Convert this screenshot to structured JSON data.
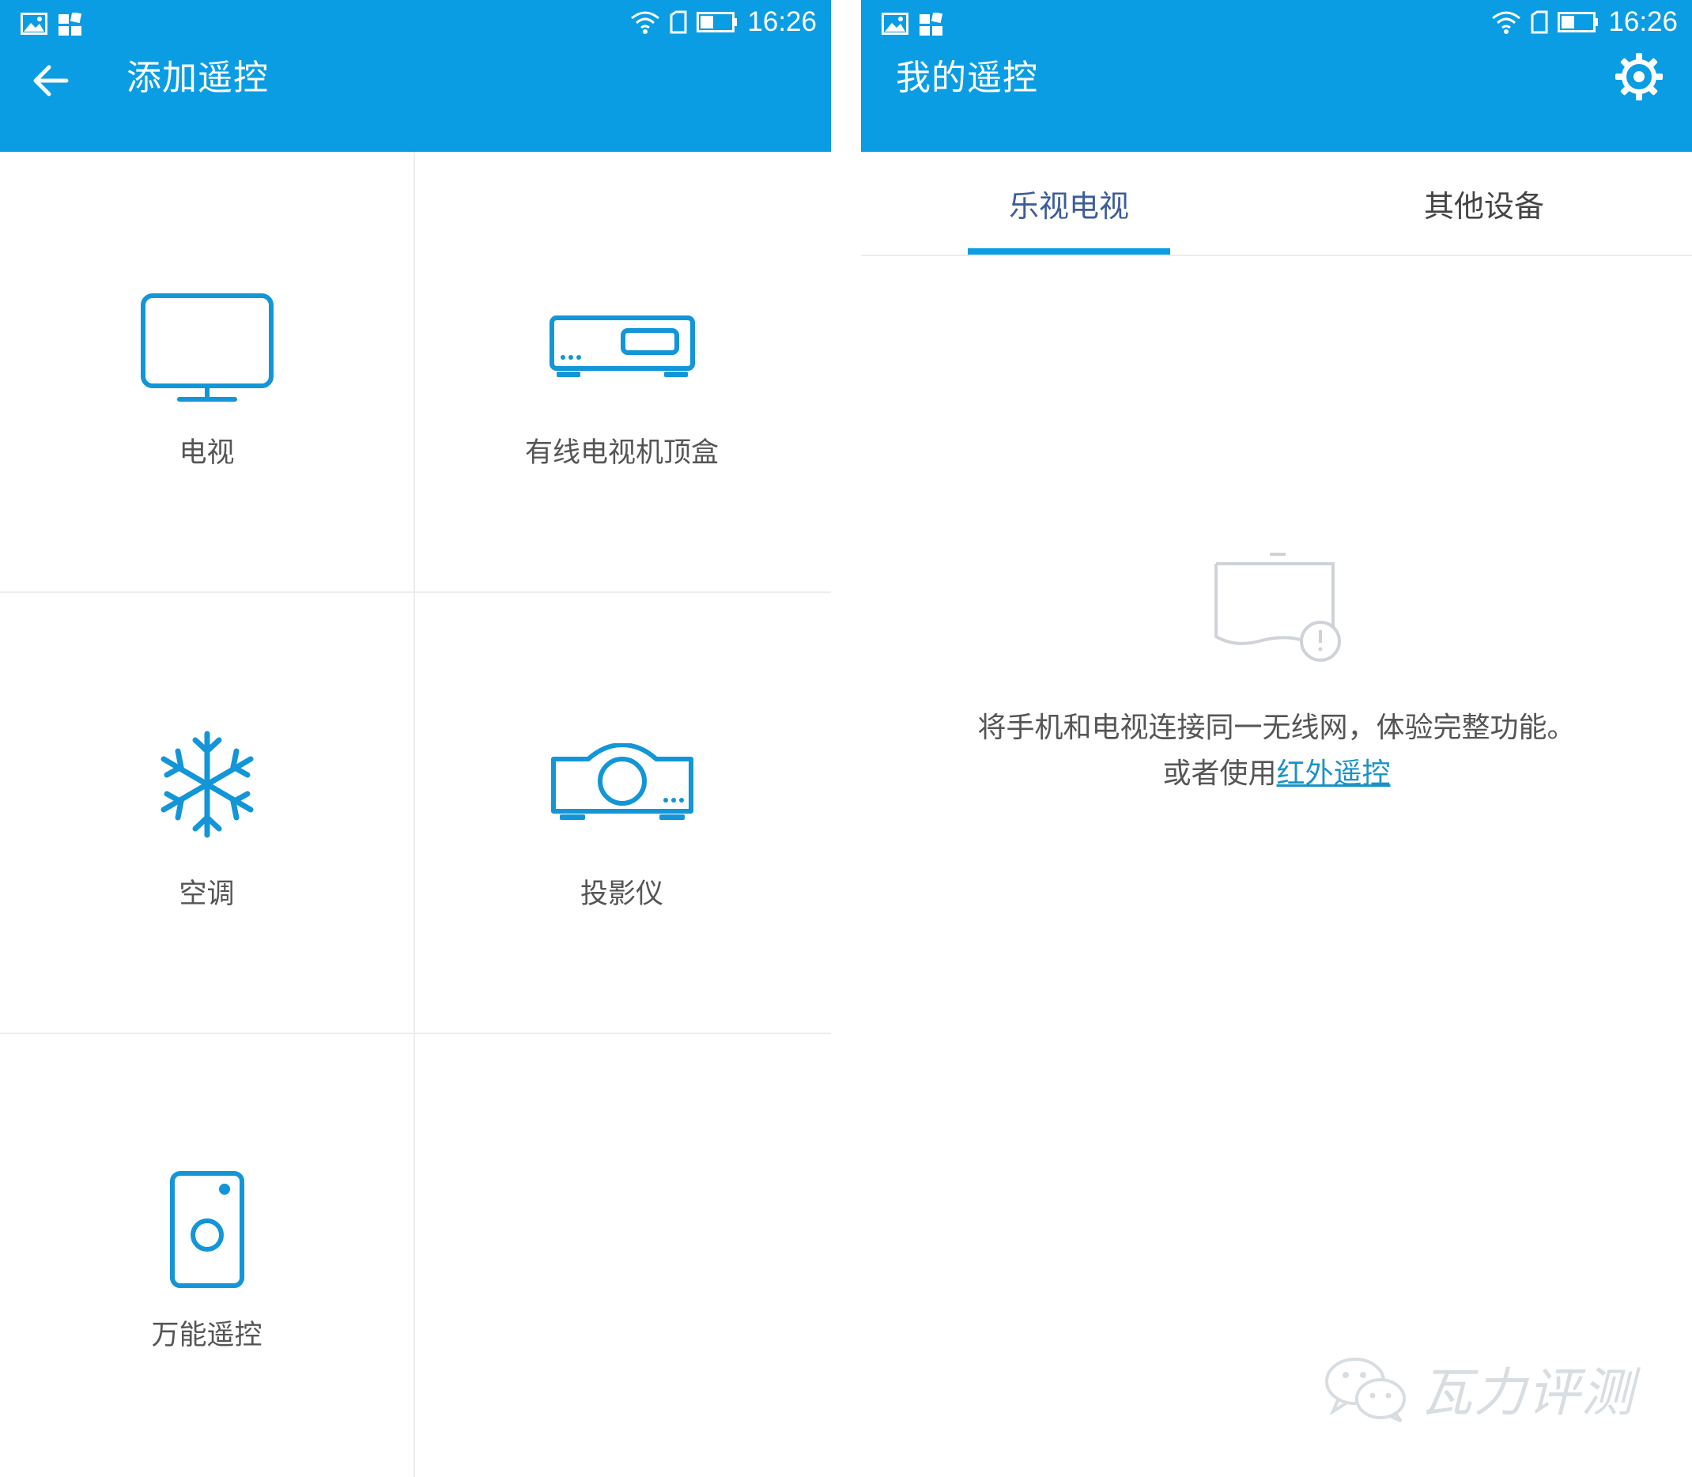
{
  "colors": {
    "header": "#0a9de3",
    "icon": "#1296d8",
    "active_tab": "#3d5d9a",
    "link": "#1a92c6"
  },
  "left": {
    "status": {
      "time": "16:26"
    },
    "title": "添加遥控",
    "devices": [
      {
        "label": "电视",
        "icon": "tv-icon"
      },
      {
        "label": "有线电视机顶盒",
        "icon": "set-top-box-icon"
      },
      {
        "label": "空调",
        "icon": "snowflake-icon"
      },
      {
        "label": "投影仪",
        "icon": "projector-icon"
      },
      {
        "label": "万能遥控",
        "icon": "universal-remote-icon"
      }
    ]
  },
  "right": {
    "status": {
      "time": "16:26"
    },
    "title": "我的遥控",
    "tabs": [
      {
        "label": "乐视电视",
        "active": true
      },
      {
        "label": "其他设备",
        "active": false
      }
    ],
    "empty": {
      "message": "将手机和电视连接同一无线网，体验完整功能。",
      "prefix": "或者使用",
      "link": "红外遥控"
    }
  },
  "watermark": "瓦力评测"
}
